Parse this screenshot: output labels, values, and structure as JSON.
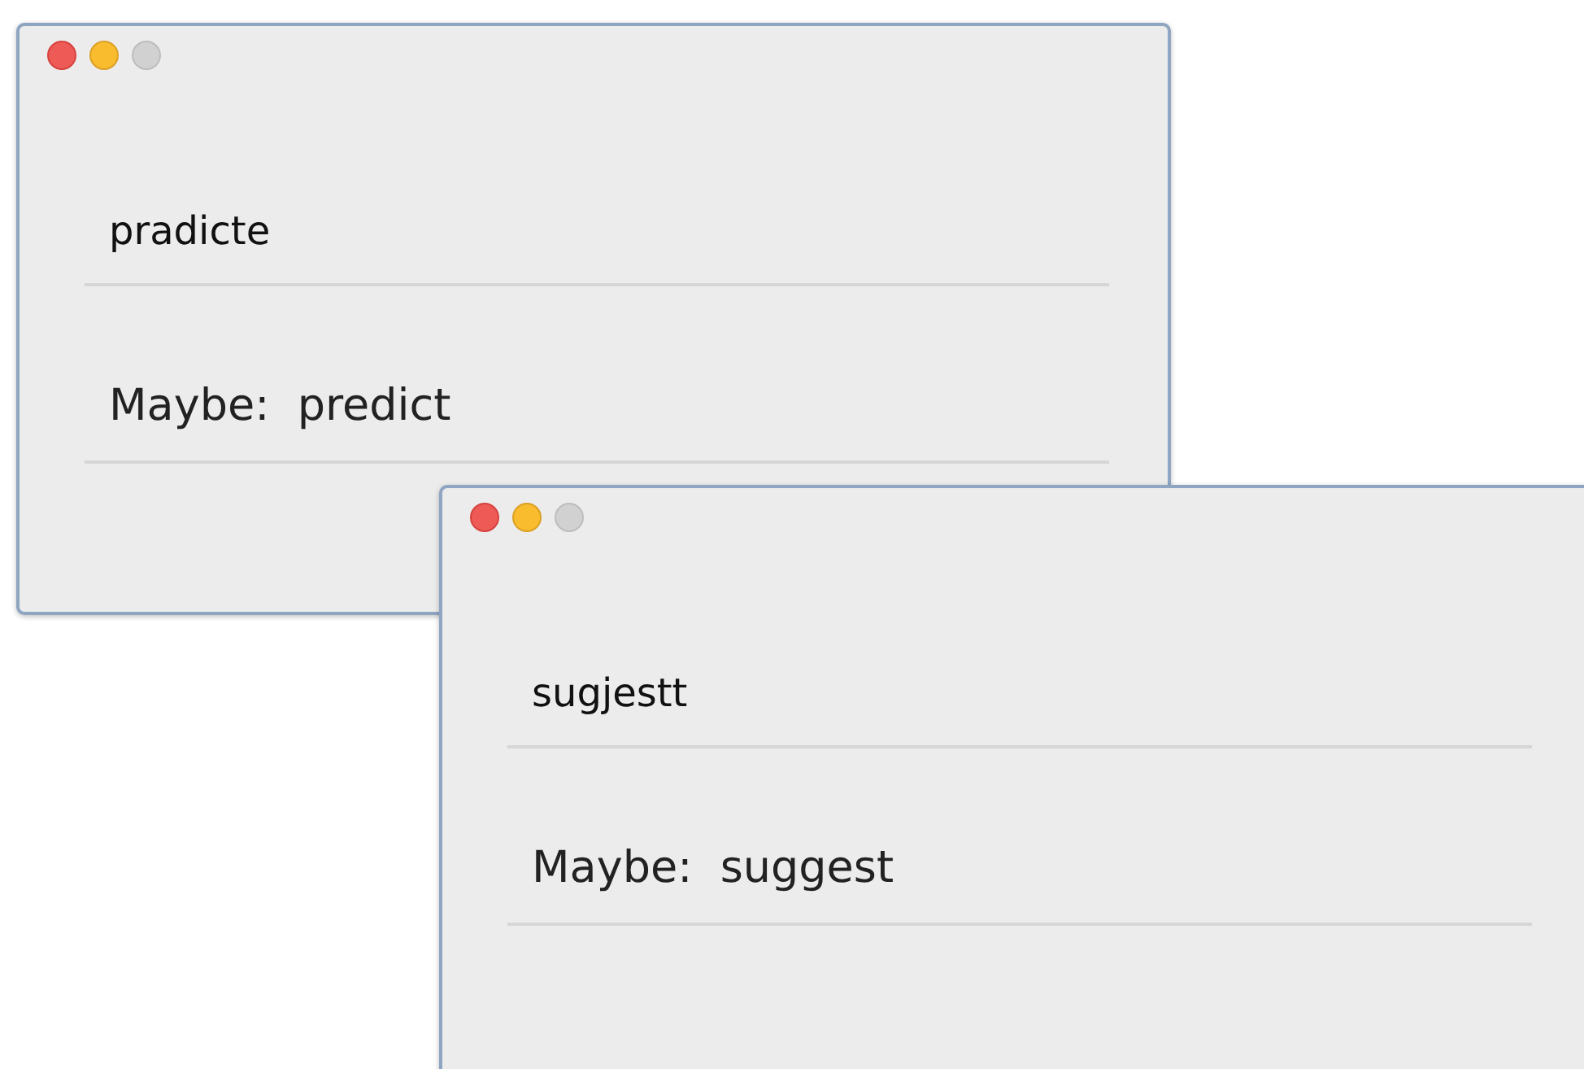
{
  "windows": [
    {
      "input": {
        "value": "pradicte"
      },
      "suggestion": "Maybe:  predict"
    },
    {
      "input": {
        "value": "sugjestt"
      },
      "suggestion": "Maybe:  suggest"
    }
  ]
}
